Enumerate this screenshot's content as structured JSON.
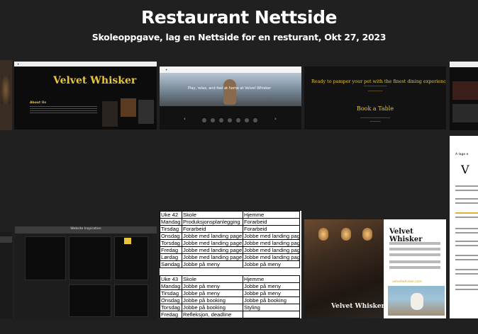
{
  "header": {
    "title": "Restaurant Nettside",
    "subtitle": "Skoleoppgave, lag en Nettside for en resturant, Okt 27, 2023"
  },
  "thumbnails": {
    "velvet": {
      "brand": "Velvet Whisker",
      "about": "About Us"
    },
    "dog": {
      "hero": "Play, relax, and feel at home at Velvet Whisker"
    },
    "booking": {
      "heading": "Ready to pamper your pet with the finest dining experience?",
      "button": "Book a Table"
    },
    "mockup": {
      "caption": "Website Inspiration"
    },
    "poster": {
      "brand": "Velvet Whisker",
      "photo_logo": "Velvet Whisker",
      "url": "velvetwhisker.com"
    },
    "doc": {
      "letter": "V",
      "heading": "A lage e"
    }
  },
  "schedule": {
    "week1": {
      "header": [
        "Uke 42",
        "Skole",
        "Hjemme"
      ],
      "rows": [
        [
          "Mandag",
          "Produksjonsplanlegging",
          "Forarbeid"
        ],
        [
          "Tirsdag",
          "Forarbeid",
          "Forarbeid"
        ],
        [
          "Onsdag",
          "Jobbe med landing page",
          "Jobbe med landing page"
        ],
        [
          "Torsdag",
          "Jobbe med landing page",
          "Jobbe med landing page"
        ],
        [
          "Fredag",
          "Jobbe med landing page",
          "Jobbe med landing page"
        ],
        [
          "Lørdag",
          "Jobbe med landing page",
          "Jobbe med landing page"
        ],
        [
          "Søndag",
          "Jobbe på meny",
          "Jobbe på meny"
        ]
      ]
    },
    "week2": {
      "header": [
        "Uke 43",
        "Skole",
        "Hjemme"
      ],
      "rows": [
        [
          "Mandag",
          "Jobbe på meny",
          "Jobbe på meny"
        ],
        [
          "Tirsdag",
          "Jobbe på meny",
          "Jobbe på meny"
        ],
        [
          "Onsdag",
          "Jobbe på booking",
          "Jobbe på booking"
        ],
        [
          "Torsdag",
          "Jobbe på booking",
          "Styling"
        ],
        [
          "Fredag",
          "Refleksjon, deadline",
          ""
        ]
      ]
    }
  }
}
